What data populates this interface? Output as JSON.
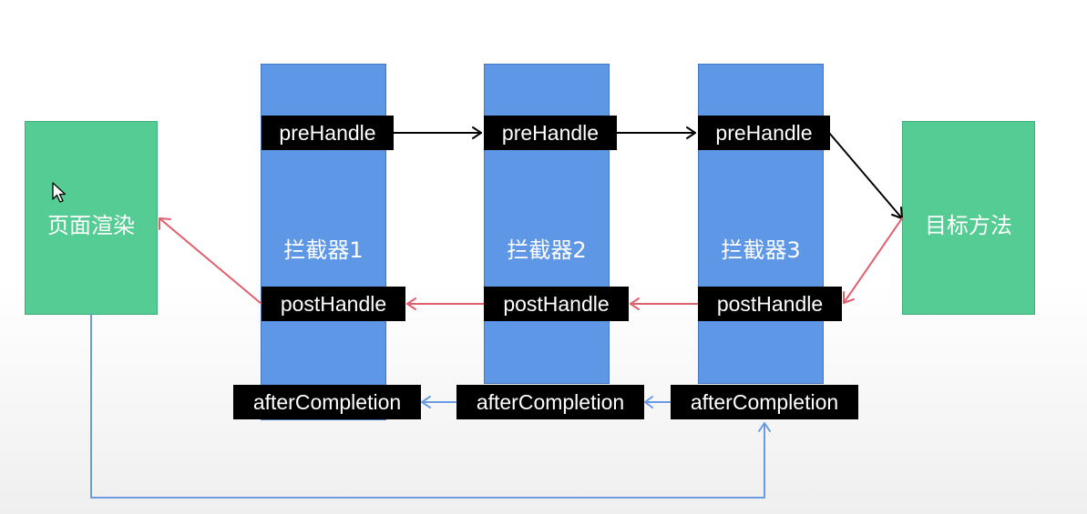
{
  "render_box": {
    "label": "页面渲染"
  },
  "target_box": {
    "label": "目标方法"
  },
  "interceptors": [
    {
      "label": "拦截器1",
      "pre": "preHandle",
      "post": "postHandle",
      "after": "afterCompletion"
    },
    {
      "label": "拦截器2",
      "pre": "preHandle",
      "post": "postHandle",
      "after": "afterCompletion"
    },
    {
      "label": "拦截器3",
      "pre": "preHandle",
      "post": "postHandle",
      "after": "afterCompletion"
    }
  ],
  "colors": {
    "green": "#55cc93",
    "blue": "#5e97e6",
    "pre_arrow": "#000000",
    "post_arrow": "#e0606e",
    "after_arrow": "#6a9be0"
  },
  "icons": [
    "mouse-pointer-icon"
  ]
}
